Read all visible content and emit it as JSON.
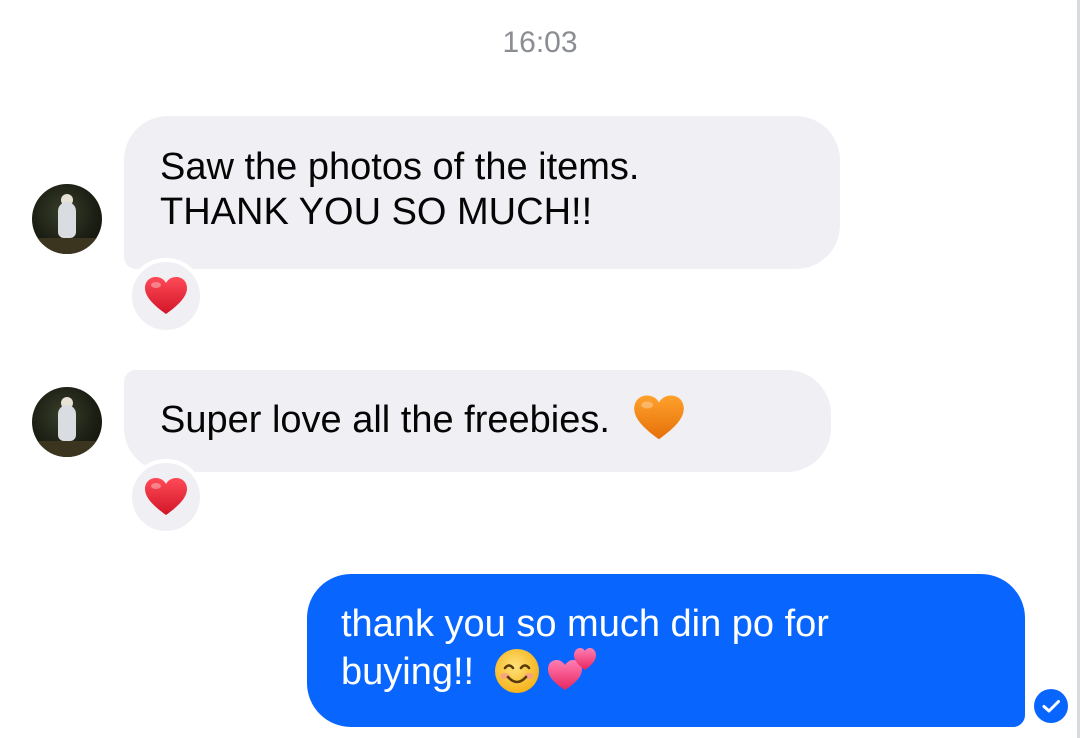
{
  "timestamp": "16:03",
  "messages": [
    {
      "direction": "incoming",
      "lines": [
        "Saw the photos of the items.",
        "THANK YOU SO MUCH!!"
      ],
      "reaction": "red-heart"
    },
    {
      "direction": "incoming",
      "text": "Super love all the freebies.",
      "trailing_emoji": "orange-heart",
      "reaction": "red-heart"
    },
    {
      "direction": "outgoing",
      "lines": [
        "thank you so much din po for",
        "buying!!"
      ],
      "trailing_emojis": [
        "smiling-face-with-smiling-eyes",
        "two-hearts"
      ],
      "status": "sent"
    }
  ],
  "colors": {
    "incoming_bubble": "#f0f0f4",
    "outgoing_bubble": "#0866ff",
    "timestamp_text": "#8a8d91",
    "heart_red": "#e8202e",
    "heart_orange": "#f58a0c"
  }
}
